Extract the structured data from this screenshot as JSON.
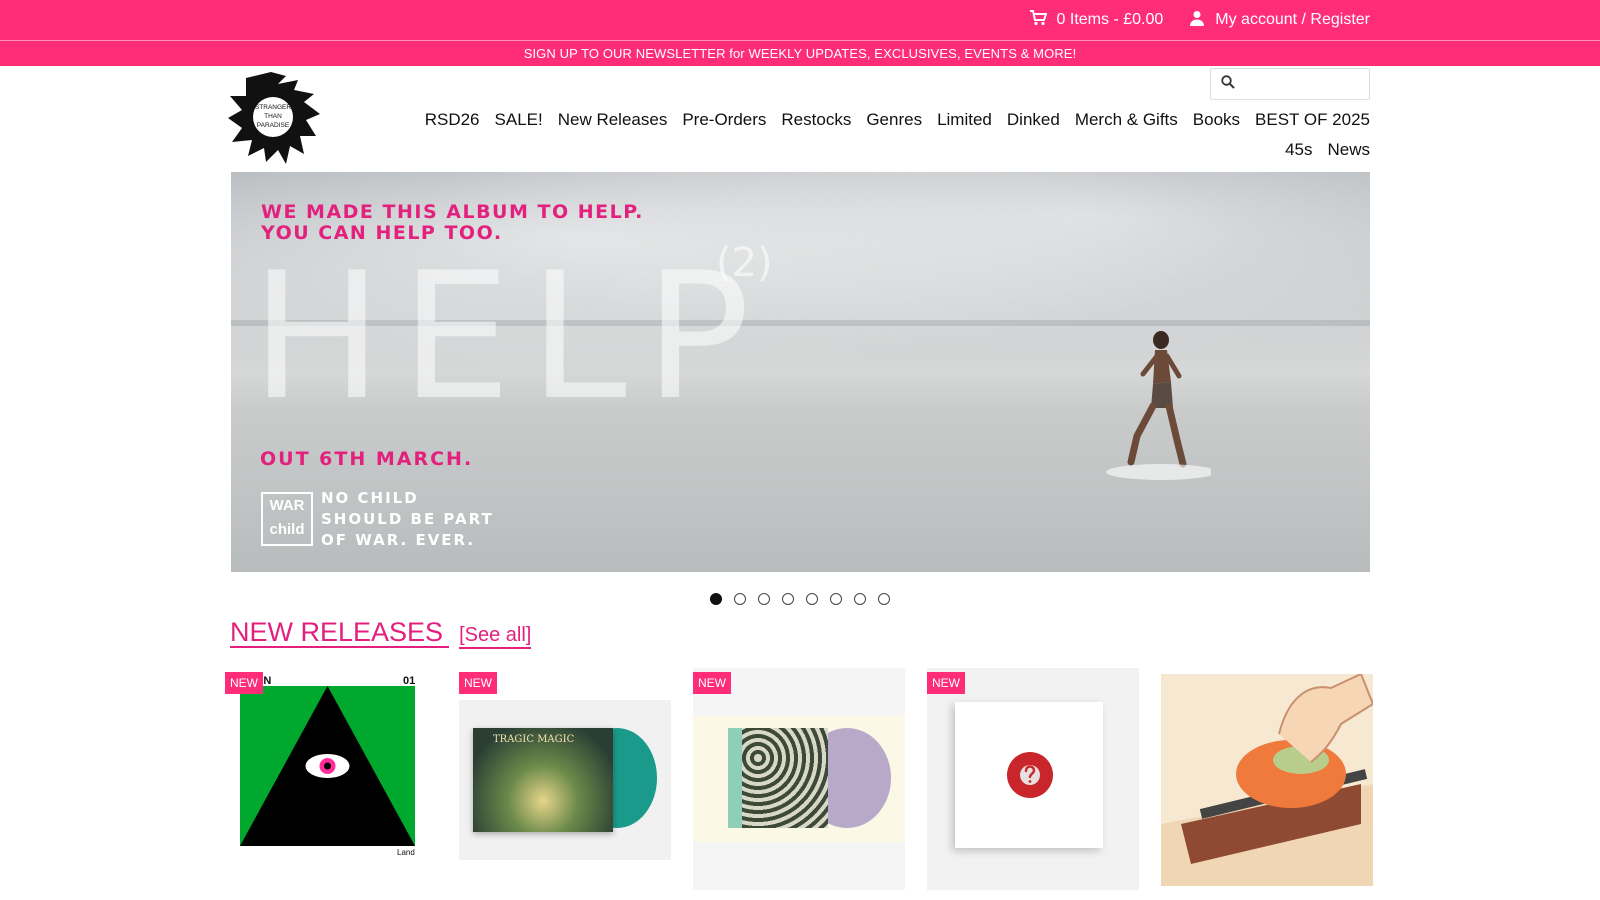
{
  "topbar": {
    "cart_label": "0 Items - £0.00",
    "account_label": "My account / Register"
  },
  "newsletter": {
    "text": "SIGN UP TO OUR NEWSLETTER for WEEKLY UPDATES, EXCLUSIVES, EVENTS & MORE!"
  },
  "logo": {
    "text_line1": "STRANGER",
    "text_line2": "THAN",
    "text_line3": "PARADISE"
  },
  "search": {
    "placeholder": ""
  },
  "nav": {
    "row1": [
      "RSD26",
      "SALE!",
      "New Releases",
      "Pre-Orders",
      "Restocks",
      "Genres",
      "Limited",
      "Dinked",
      "Merch & Gifts",
      "Books",
      "BEST OF 2025"
    ],
    "row2": [
      "45s",
      "News"
    ]
  },
  "hero": {
    "tagline_line1": "WE MADE THIS ALBUM TO HELP.",
    "tagline_line2": "YOU CAN HELP TOO.",
    "big_title": "HELP",
    "superscript": "(2)",
    "date": "OUT 6TH MARCH.",
    "badge_top": "WAR",
    "badge_bottom": "child",
    "slogan_line1": "NO CHILD",
    "slogan_line2": "SHOULD BE PART",
    "slogan_line3": "OF WAR. EVER."
  },
  "carousel": {
    "count": 8,
    "active_index": 0
  },
  "section": {
    "title": "NEW RELEASES",
    "see_all": "[See all]"
  },
  "products": [
    {
      "badge": "NEW",
      "cover_text_left": "BE.N",
      "cover_text_right": "01",
      "cover_text_bottom": "Land"
    },
    {
      "badge": "NEW",
      "cover_text": "TRAGIC MAGIC"
    },
    {
      "badge": "NEW"
    },
    {
      "badge": "NEW"
    },
    {
      "badge": ""
    }
  ],
  "colors": {
    "brand_pink": "#ff2d78",
    "accent_pink": "#e3207d"
  }
}
